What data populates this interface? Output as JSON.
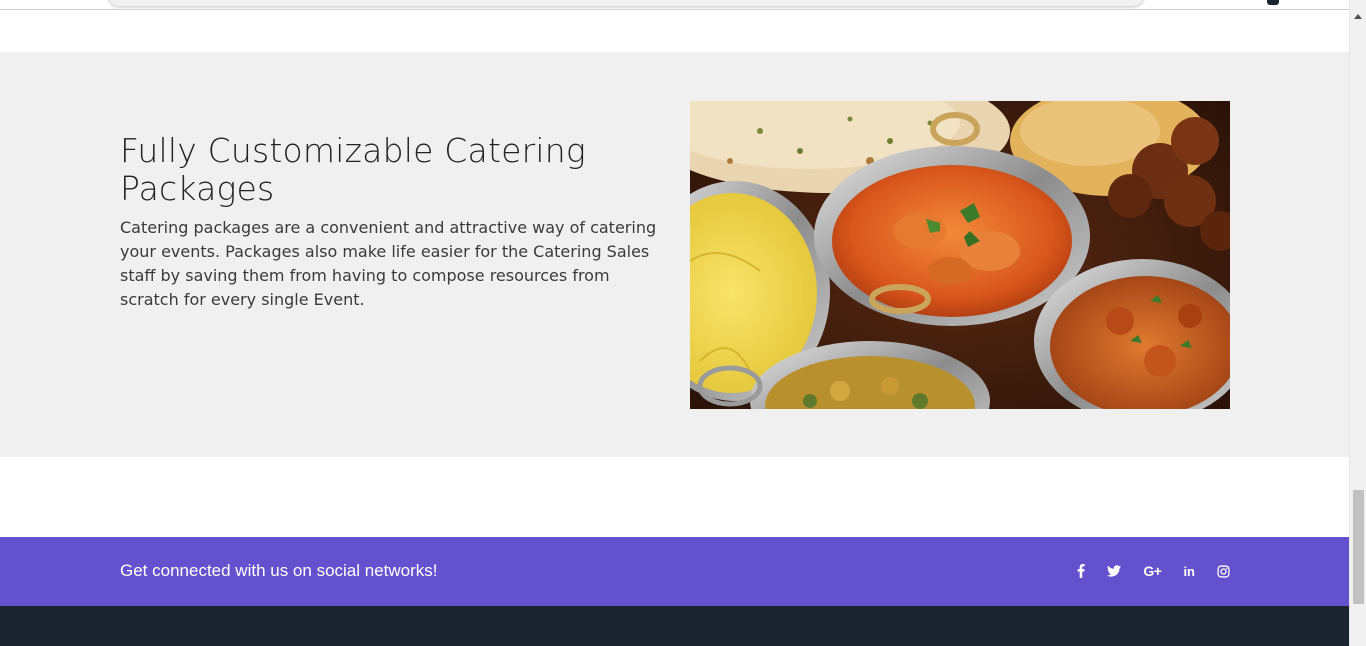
{
  "feature": {
    "title": "Fully Customizable Catering Packages",
    "description": "Catering packages are a convenient and attractive way of catering your events. Packages also make life easier for the Catering Sales staff by saving them from having to compose resources from scratch for every single Event."
  },
  "social": {
    "text": "Get connected with us on social networks!",
    "icons": [
      {
        "name": "facebook-icon",
        "glyph": "f"
      },
      {
        "name": "twitter-icon",
        "glyph": "twitter"
      },
      {
        "name": "google-plus-icon",
        "glyph": "G+"
      },
      {
        "name": "linkedin-icon",
        "glyph": "in"
      },
      {
        "name": "instagram-icon",
        "glyph": "instagram"
      }
    ]
  },
  "colors": {
    "social_bar": "#6351ce",
    "footer": "#1c2331",
    "feature_bg": "#f0f0f0"
  }
}
